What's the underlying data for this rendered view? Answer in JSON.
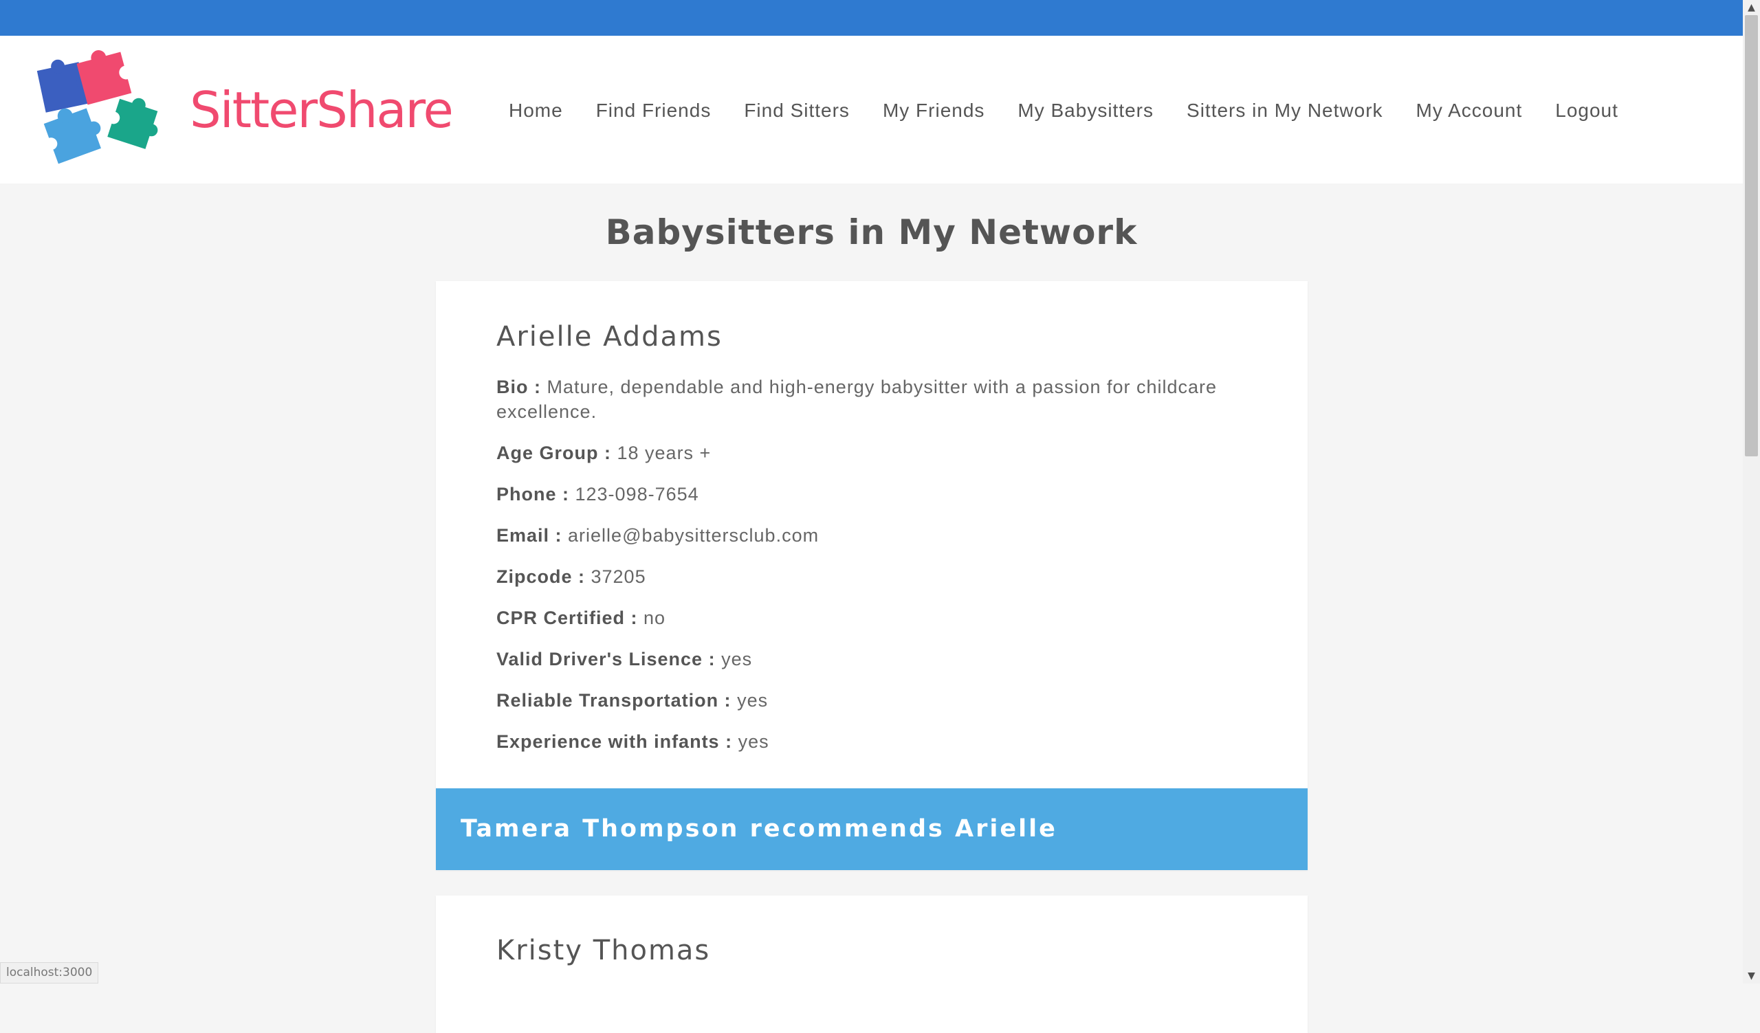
{
  "brand": {
    "name": "SitterShare"
  },
  "nav": [
    {
      "label": "Home"
    },
    {
      "label": "Find Friends"
    },
    {
      "label": "Find Sitters"
    },
    {
      "label": "My Friends"
    },
    {
      "label": "My Babysitters"
    },
    {
      "label": "Sitters in My Network"
    },
    {
      "label": "My Account"
    },
    {
      "label": "Logout"
    }
  ],
  "page": {
    "title": "Babysitters in My Network"
  },
  "sitters": [
    {
      "name": "Arielle Addams",
      "fields": [
        {
          "label": "Bio :",
          "value": " Mature, dependable and high-energy babysitter with a passion for childcare excellence."
        },
        {
          "label": "Age Group :",
          "value": " 18 years +"
        },
        {
          "label": "Phone :",
          "value": " 123-098-7654"
        },
        {
          "label": "Email :",
          "value": " arielle@babysittersclub.com"
        },
        {
          "label": "Zipcode :",
          "value": " 37205"
        },
        {
          "label": "CPR Certified :",
          "value": " no"
        },
        {
          "label": "Valid Driver's Lisence :",
          "value": " yes"
        },
        {
          "label": "Reliable Transportation :",
          "value": " yes"
        },
        {
          "label": "Experience with infants :",
          "value": " yes"
        }
      ],
      "recommendation": "Tamera Thompson recommends Arielle"
    },
    {
      "name": "Kristy Thomas"
    }
  ],
  "status_bar": {
    "url": "localhost:3000"
  },
  "colors": {
    "top_strip": "#2f7ad0",
    "brand": "#f04a6f",
    "recommend_bar": "#4faae2",
    "puzzle_dark_blue": "#3b5fc0",
    "puzzle_pink": "#f04a6f",
    "puzzle_light_blue": "#4aa3df",
    "puzzle_teal": "#1aa68a"
  }
}
